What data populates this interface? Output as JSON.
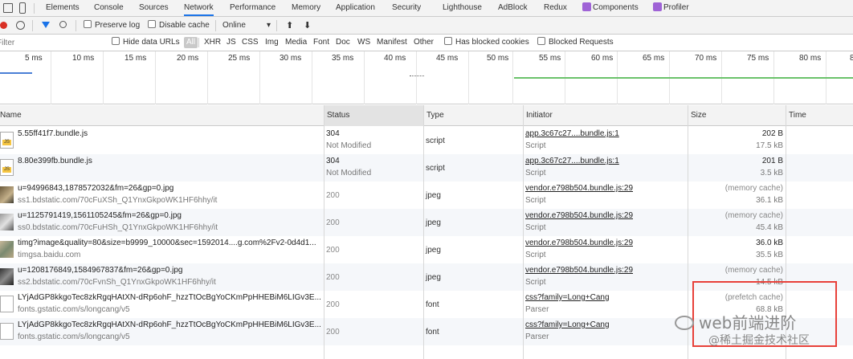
{
  "tabs": [
    "Elements",
    "Console",
    "Sources",
    "Network",
    "Performance",
    "Memory",
    "Application",
    "Security",
    "Lighthouse",
    "AdBlock",
    "Redux",
    "Components",
    "Profiler"
  ],
  "active_tab": "Network",
  "toolbar": {
    "preserve_log": "Preserve log",
    "disable_cache": "Disable cache",
    "throttle": "Online"
  },
  "filter": {
    "placeholder": "Filter",
    "hide_data_urls": "Hide data URLs",
    "all": "All",
    "types": [
      "XHR",
      "JS",
      "CSS",
      "Img",
      "Media",
      "Font",
      "Doc",
      "WS",
      "Manifest",
      "Other"
    ],
    "has_blocked_cookies": "Has blocked cookies",
    "blocked_requests": "Blocked Requests"
  },
  "timeline_ticks": [
    "5 ms",
    "10 ms",
    "15 ms",
    "20 ms",
    "25 ms",
    "30 ms",
    "35 ms",
    "40 ms",
    "45 ms",
    "50 ms",
    "55 ms",
    "60 ms",
    "65 ms",
    "70 ms",
    "75 ms",
    "80 ms",
    "8"
  ],
  "columns": {
    "name": "Name",
    "status": "Status",
    "type": "Type",
    "initiator": "Initiator",
    "size": "Size",
    "time": "Time"
  },
  "rows": [
    {
      "name": "5.55ff41f7.bundle.js",
      "url": "",
      "status": "304",
      "status_text": "Not Modified",
      "type": "script",
      "initiator": "app.3c67c27....bundle.js:1",
      "initiator_type": "Script",
      "size1": "202 B",
      "size2": "17.5 kB",
      "icon": "js-file-icon"
    },
    {
      "name": "8.80e399fb.bundle.js",
      "url": "",
      "status": "304",
      "status_text": "Not Modified",
      "type": "script",
      "initiator": "app.3c67c27....bundle.js:1",
      "initiator_type": "Script",
      "size1": "201 B",
      "size2": "3.5 kB",
      "icon": "js-file-icon"
    },
    {
      "name": "u=94996843,1878572032&fm=26&gp=0.jpg",
      "url": "ss1.bdstatic.com/70cFuXSh_Q1YnxGkpoWK1HF6hhy/it",
      "status": "200",
      "status_text": "",
      "type": "jpeg",
      "initiator": "vendor.e798b504.bundle.js:29",
      "initiator_type": "Script",
      "size1": "(memory cache)",
      "size2": "36.1 kB",
      "icon": "image-thumbnail-icon"
    },
    {
      "name": "u=1125791419,1561105245&fm=26&gp=0.jpg",
      "url": "ss0.bdstatic.com/70cFuHSh_Q1YnxGkpoWK1HF6hhy/it",
      "status": "200",
      "status_text": "",
      "type": "jpeg",
      "initiator": "vendor.e798b504.bundle.js:29",
      "initiator_type": "Script",
      "size1": "(memory cache)",
      "size2": "45.4 kB",
      "icon": "image-thumbnail-icon"
    },
    {
      "name": "timg?image&quality=80&size=b9999_10000&sec=1592014....g.com%2Fv2-0d4d1...",
      "url": "timgsa.baidu.com",
      "status": "200",
      "status_text": "",
      "type": "jpeg",
      "initiator": "vendor.e798b504.bundle.js:29",
      "initiator_type": "Script",
      "size1": "36.0 kB",
      "size2": "35.5 kB",
      "icon": "image-thumbnail-icon"
    },
    {
      "name": "u=1208176849,1584967837&fm=26&gp=0.jpg",
      "url": "ss2.bdstatic.com/70cFvnSh_Q1YnxGkpoWK1HF6hhy/it",
      "status": "200",
      "status_text": "",
      "type": "jpeg",
      "initiator": "vendor.e798b504.bundle.js:29",
      "initiator_type": "Script",
      "size1": "(memory cache)",
      "size2": "14.5 kB",
      "icon": "image-thumbnail-icon"
    },
    {
      "name": "LYjAdGP8kkgoTec8zkRgqHAtXN-dRp6ohF_hzzTtOcBgYoCKmPpHHEBiM6LIGv3E...",
      "url": "fonts.gstatic.com/s/longcang/v5",
      "status": "200",
      "status_text": "",
      "type": "font",
      "initiator": "css?family=Long+Cang",
      "initiator_type": "Parser",
      "size1": "(prefetch cache)",
      "size2": "68.8 kB",
      "icon": "file-icon"
    },
    {
      "name": "LYjAdGP8kkgoTec8zkRgqHAtXN-dRp6ohF_hzzTtOcBgYoCKmPpHHEBiM6LIGv3E...",
      "url": "fonts.gstatic.com/s/longcang/v5",
      "status": "200",
      "status_text": "",
      "type": "font",
      "initiator": "css?family=Long+Cang",
      "initiator_type": "Parser",
      "size1": "",
      "size2": "",
      "icon": "file-icon"
    }
  ],
  "watermark": {
    "line1": "web前端进阶",
    "line2": "@稀土掘金技术社区"
  }
}
